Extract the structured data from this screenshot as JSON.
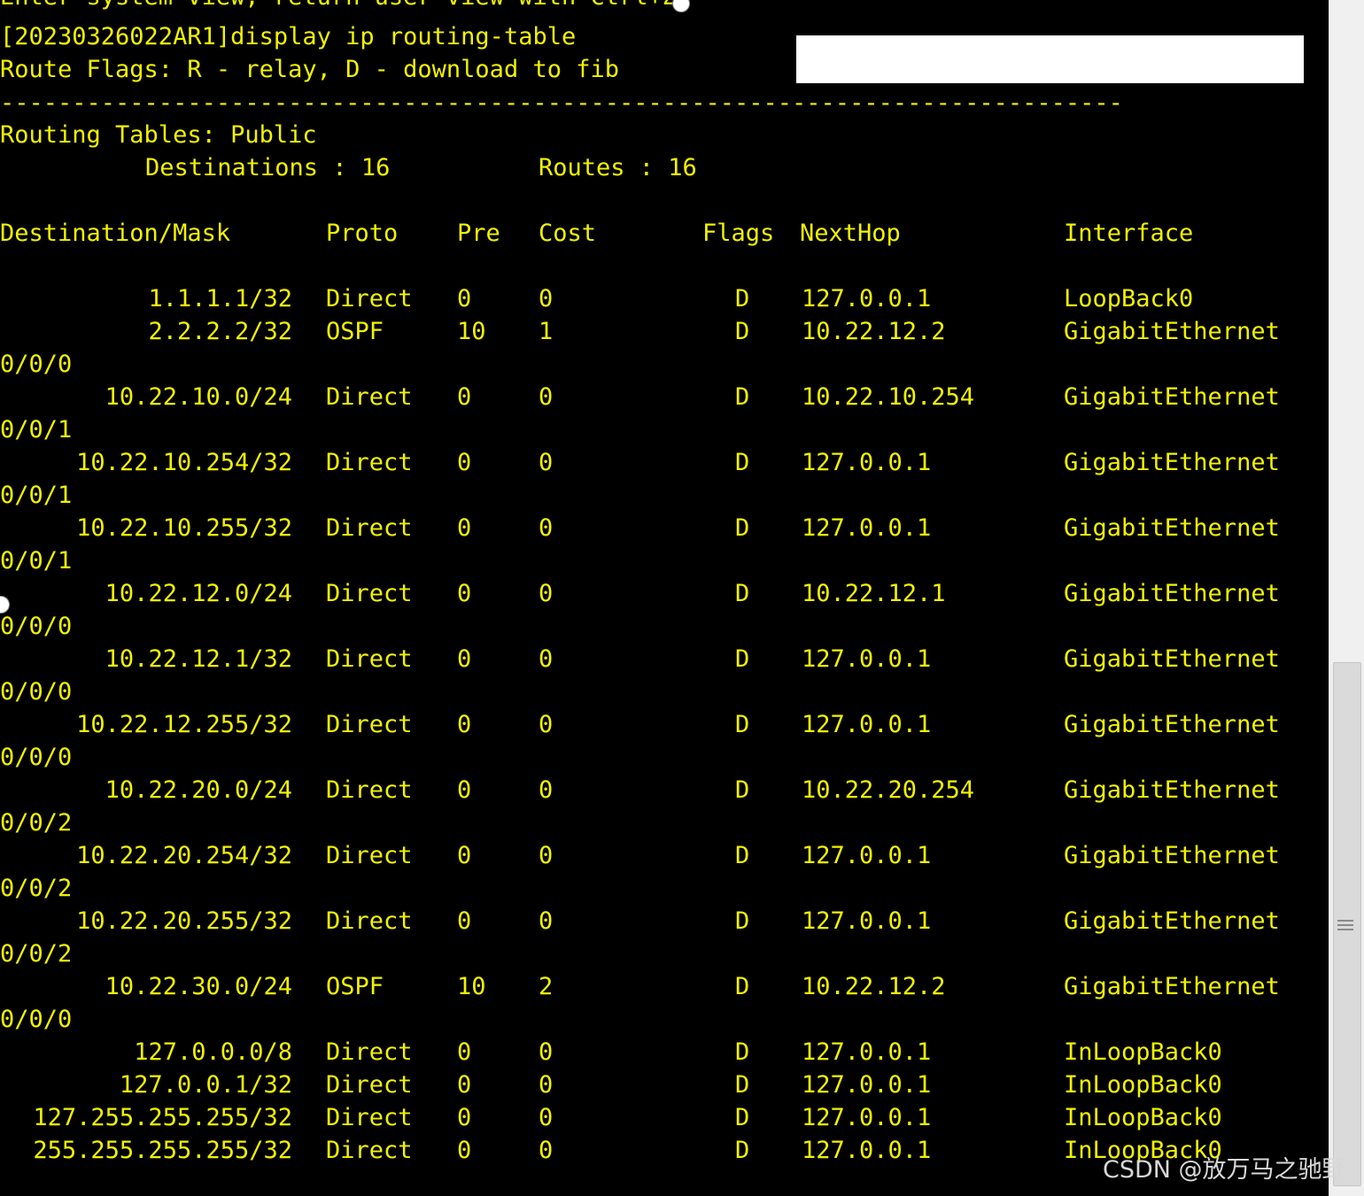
{
  "terminal": {
    "partial_top_line": "Enter system view, return user view with Ctrl+Z.",
    "command_line": "[20230326022AR1]display ip routing-table",
    "flags_legend": "Route Flags: R - relay, D - download to fib",
    "separator": "------------------------------------------------------------------------------",
    "table_title": "Routing Tables: Public",
    "destinations_label": "Destinations : 16",
    "routes_label": "Routes : 16",
    "headers": {
      "destination": "Destination/Mask",
      "proto": "Proto",
      "pre": "Pre",
      "cost": "Cost",
      "flags": "Flags",
      "nexthop": "NextHop",
      "interface": "Interface"
    },
    "routes": [
      {
        "dest": "1.1.1.1/32",
        "proto": "Direct",
        "pre": "0",
        "cost": "0",
        "flags": "D",
        "nexthop": "127.0.0.1",
        "iface": "LoopBack0",
        "iface_cont": ""
      },
      {
        "dest": "2.2.2.2/32",
        "proto": "OSPF",
        "pre": "10",
        "cost": "1",
        "flags": "D",
        "nexthop": "10.22.12.2",
        "iface": "GigabitEthernet",
        "iface_cont": "0/0/0"
      },
      {
        "dest": "10.22.10.0/24",
        "proto": "Direct",
        "pre": "0",
        "cost": "0",
        "flags": "D",
        "nexthop": "10.22.10.254",
        "iface": "GigabitEthernet",
        "iface_cont": "0/0/1"
      },
      {
        "dest": "10.22.10.254/32",
        "proto": "Direct",
        "pre": "0",
        "cost": "0",
        "flags": "D",
        "nexthop": "127.0.0.1",
        "iface": "GigabitEthernet",
        "iface_cont": "0/0/1"
      },
      {
        "dest": "10.22.10.255/32",
        "proto": "Direct",
        "pre": "0",
        "cost": "0",
        "flags": "D",
        "nexthop": "127.0.0.1",
        "iface": "GigabitEthernet",
        "iface_cont": "0/0/1"
      },
      {
        "dest": "10.22.12.0/24",
        "proto": "Direct",
        "pre": "0",
        "cost": "0",
        "flags": "D",
        "nexthop": "10.22.12.1",
        "iface": "GigabitEthernet",
        "iface_cont": "0/0/0"
      },
      {
        "dest": "10.22.12.1/32",
        "proto": "Direct",
        "pre": "0",
        "cost": "0",
        "flags": "D",
        "nexthop": "127.0.0.1",
        "iface": "GigabitEthernet",
        "iface_cont": "0/0/0"
      },
      {
        "dest": "10.22.12.255/32",
        "proto": "Direct",
        "pre": "0",
        "cost": "0",
        "flags": "D",
        "nexthop": "127.0.0.1",
        "iface": "GigabitEthernet",
        "iface_cont": "0/0/0"
      },
      {
        "dest": "10.22.20.0/24",
        "proto": "Direct",
        "pre": "0",
        "cost": "0",
        "flags": "D",
        "nexthop": "10.22.20.254",
        "iface": "GigabitEthernet",
        "iface_cont": "0/0/2"
      },
      {
        "dest": "10.22.20.254/32",
        "proto": "Direct",
        "pre": "0",
        "cost": "0",
        "flags": "D",
        "nexthop": "127.0.0.1",
        "iface": "GigabitEthernet",
        "iface_cont": "0/0/2"
      },
      {
        "dest": "10.22.20.255/32",
        "proto": "Direct",
        "pre": "0",
        "cost": "0",
        "flags": "D",
        "nexthop": "127.0.0.1",
        "iface": "GigabitEthernet",
        "iface_cont": "0/0/2"
      },
      {
        "dest": "10.22.30.0/24",
        "proto": "OSPF",
        "pre": "10",
        "cost": "2",
        "flags": "D",
        "nexthop": "10.22.12.2",
        "iface": "GigabitEthernet",
        "iface_cont": "0/0/0"
      },
      {
        "dest": "127.0.0.0/8",
        "proto": "Direct",
        "pre": "0",
        "cost": "0",
        "flags": "D",
        "nexthop": "127.0.0.1",
        "iface": "InLoopBack0",
        "iface_cont": ""
      },
      {
        "dest": "127.0.0.1/32",
        "proto": "Direct",
        "pre": "0",
        "cost": "0",
        "flags": "D",
        "nexthop": "127.0.0.1",
        "iface": "InLoopBack0",
        "iface_cont": ""
      },
      {
        "dest": "127.255.255.255/32",
        "proto": "Direct",
        "pre": "0",
        "cost": "0",
        "flags": "D",
        "nexthop": "127.0.0.1",
        "iface": "InLoopBack0",
        "iface_cont": ""
      },
      {
        "dest": "255.255.255.255/32",
        "proto": "Direct",
        "pre": "0",
        "cost": "0",
        "flags": "D",
        "nexthop": "127.0.0.1",
        "iface": "InLoopBack0",
        "iface_cont": ""
      }
    ]
  },
  "watermark": "CSDN @放万马之驰野",
  "colors": {
    "background": "#000000",
    "text": "#f2f200",
    "redaction": "#ffffff"
  }
}
